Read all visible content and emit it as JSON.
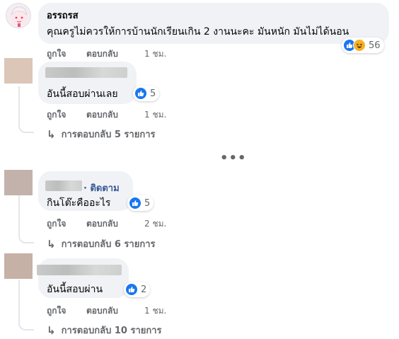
{
  "comments": [
    {
      "author": "อรรถรส",
      "text": "คุณครูไม่ควรให้การบ้านนักเรียนเกิน 2 งานนะคะ มันหนัก มันไม่ได้นอน",
      "reactions": [
        "like-icon",
        "haha-icon"
      ],
      "reaction_count": "56",
      "like_label": "ถูกใจ",
      "reply_label": "ตอบกลับ",
      "time": "1 ชม."
    },
    {
      "author": "",
      "text": "อันนี้สอบผ่านเลย",
      "reactions": [
        "like-icon"
      ],
      "reaction_count": "5",
      "like_label": "ถูกใจ",
      "reply_label": "ตอบกลับ",
      "time": "1 ชม.",
      "replies_label": "การตอบกลับ 5 รายการ"
    },
    {
      "author": "",
      "follow_label": "· ติดตาม",
      "text": "กินโต๊ะคืออะไร",
      "reactions": [
        "like-icon"
      ],
      "reaction_count": "5",
      "like_label": "ถูกใจ",
      "reply_label": "ตอบกลับ",
      "time": "2 ชม.",
      "replies_label": "การตอบกลับ 6 รายการ"
    },
    {
      "author": "",
      "text": "อันนี้สอบผ่าน",
      "reactions": [
        "like-icon"
      ],
      "reaction_count": "2",
      "like_label": "ถูกใจ",
      "reply_label": "ตอบกลับ",
      "time": "1 ชม.",
      "replies_label": "การตอบกลับ 10 รายการ"
    }
  ],
  "more_label": "•••",
  "colors": {
    "bubble": "#f0f2f5",
    "like_blue": "#1877f2",
    "haha_yellow": "#f7b125",
    "secondary_text": "#65676b",
    "avatar_2": "#dcc6b8",
    "avatar_3": "#c3b2ab",
    "avatar_4": "#c6b1a6"
  }
}
